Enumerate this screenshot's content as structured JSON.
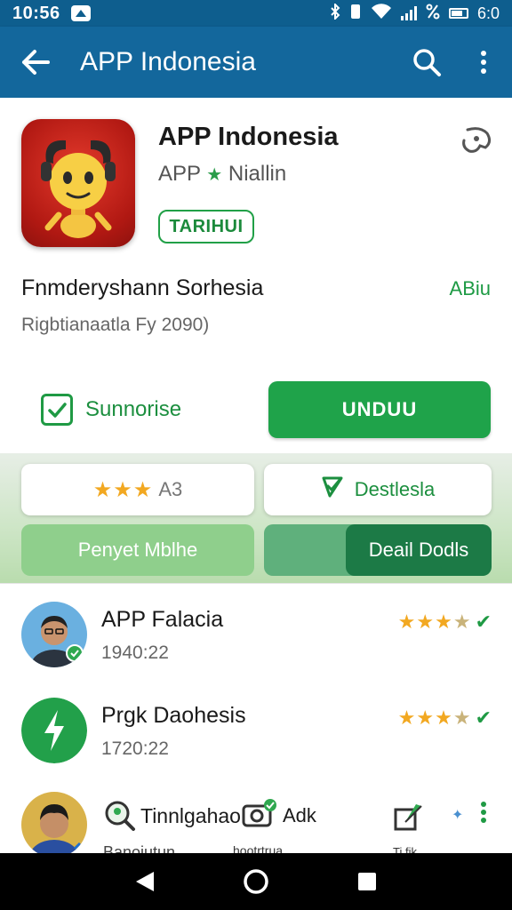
{
  "status": {
    "time": "10:56",
    "battery_text": "6:0"
  },
  "appbar": {
    "title": "APP Indonesia"
  },
  "app": {
    "title": "APP Indonesia",
    "developer": "APP",
    "developer_suffix": "Niallin",
    "tag": "TARIHUI"
  },
  "description": {
    "title": "Fnmderyshann Sorhesia",
    "side": "ABiu",
    "meta": "Rigbtianaatla Fy 2090)"
  },
  "actions": {
    "subscribe": "Sunnorise",
    "download": "UNDUU"
  },
  "tabs": {
    "rating_text": "A3",
    "destination": "Destlesla",
    "left_segment": "Penyet Mblhe",
    "right_segment": "Deail Dodls"
  },
  "reviews": [
    {
      "name": "APP Falacia",
      "meta": "1940:22",
      "stars": 3.5
    },
    {
      "name": "Prgk Daohesis",
      "meta": "1720:22",
      "stars": 3.5
    }
  ],
  "bottom_row": {
    "text_a": "Tinnlgahao",
    "text_b": "Adk",
    "small_a": "Banoiutun",
    "small_b": "hootrtrua",
    "small_c": "Ti fik"
  },
  "colors": {
    "app_bar": "#13679c",
    "status_bar": "#0e5e8e",
    "primary_green": "#1fa34a",
    "star": "#f2a821"
  }
}
